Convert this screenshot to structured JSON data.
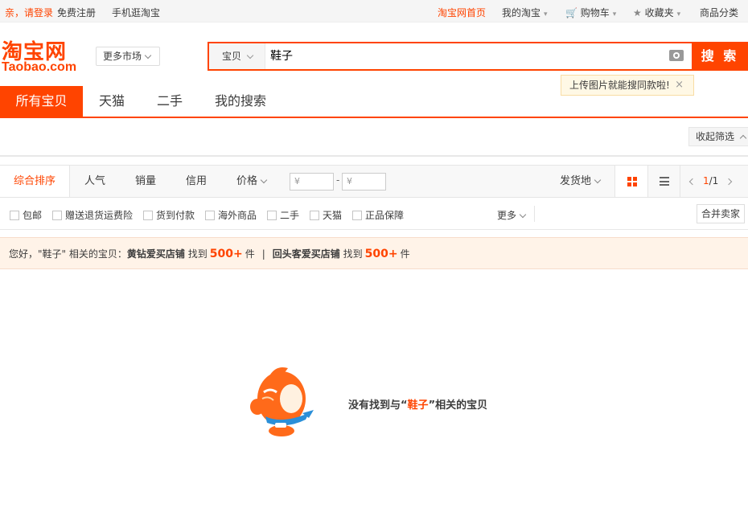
{
  "topbar": {
    "login": "亲，请登录",
    "register": "免费注册",
    "mobile": "手机逛淘宝",
    "home": "淘宝网首页",
    "my_taobao": "我的淘宝",
    "cart": "购物车",
    "favorites": "收藏夹",
    "categories": "商品分类"
  },
  "logo": {
    "cn": "淘宝网",
    "en": "Taobao.com"
  },
  "header": {
    "market_button": "更多市场"
  },
  "search": {
    "scope": "宝贝",
    "query": "鞋子",
    "button": "搜 索",
    "tip": "上传图片就能搜同款啦!",
    "tip_close": "×"
  },
  "tabs": [
    {
      "label": "所有宝贝"
    },
    {
      "label": "天猫"
    },
    {
      "label": "二手"
    },
    {
      "label": "我的搜索"
    }
  ],
  "filter": {
    "collapse": "收起筛选"
  },
  "sort": {
    "items": [
      {
        "label": "综合排序"
      },
      {
        "label": "人气"
      },
      {
        "label": "销量"
      },
      {
        "label": "信用"
      },
      {
        "label": "价格"
      }
    ],
    "price_min_placeholder": "¥",
    "price_max_placeholder": "¥",
    "price_dash": "-",
    "ship_from": "发货地",
    "page_current": "1",
    "page_total": "/1"
  },
  "checkboxes": [
    {
      "label": "包邮"
    },
    {
      "label": "赠送退货运费险"
    },
    {
      "label": "货到付款"
    },
    {
      "label": "海外商品"
    },
    {
      "label": "二手"
    },
    {
      "label": "天猫"
    },
    {
      "label": "正品保障"
    }
  ],
  "more": "更多",
  "merge_sellers": "合并卖家",
  "notice": {
    "prefix": "您好，\"鞋子\" 相关的宝贝：",
    "shop1": "黄钻爱买店铺",
    "found1": "找到",
    "count1": "500+",
    "unit1": "件",
    "sep": "|",
    "shop2": "回头客爱买店铺",
    "found2": "找到",
    "count2": "500+",
    "unit2": "件"
  },
  "empty": {
    "prefix": "没有找到与“",
    "keyword": "鞋子",
    "suffix": "”相关的宝贝"
  },
  "colors": {
    "accent": "#ff4400"
  }
}
